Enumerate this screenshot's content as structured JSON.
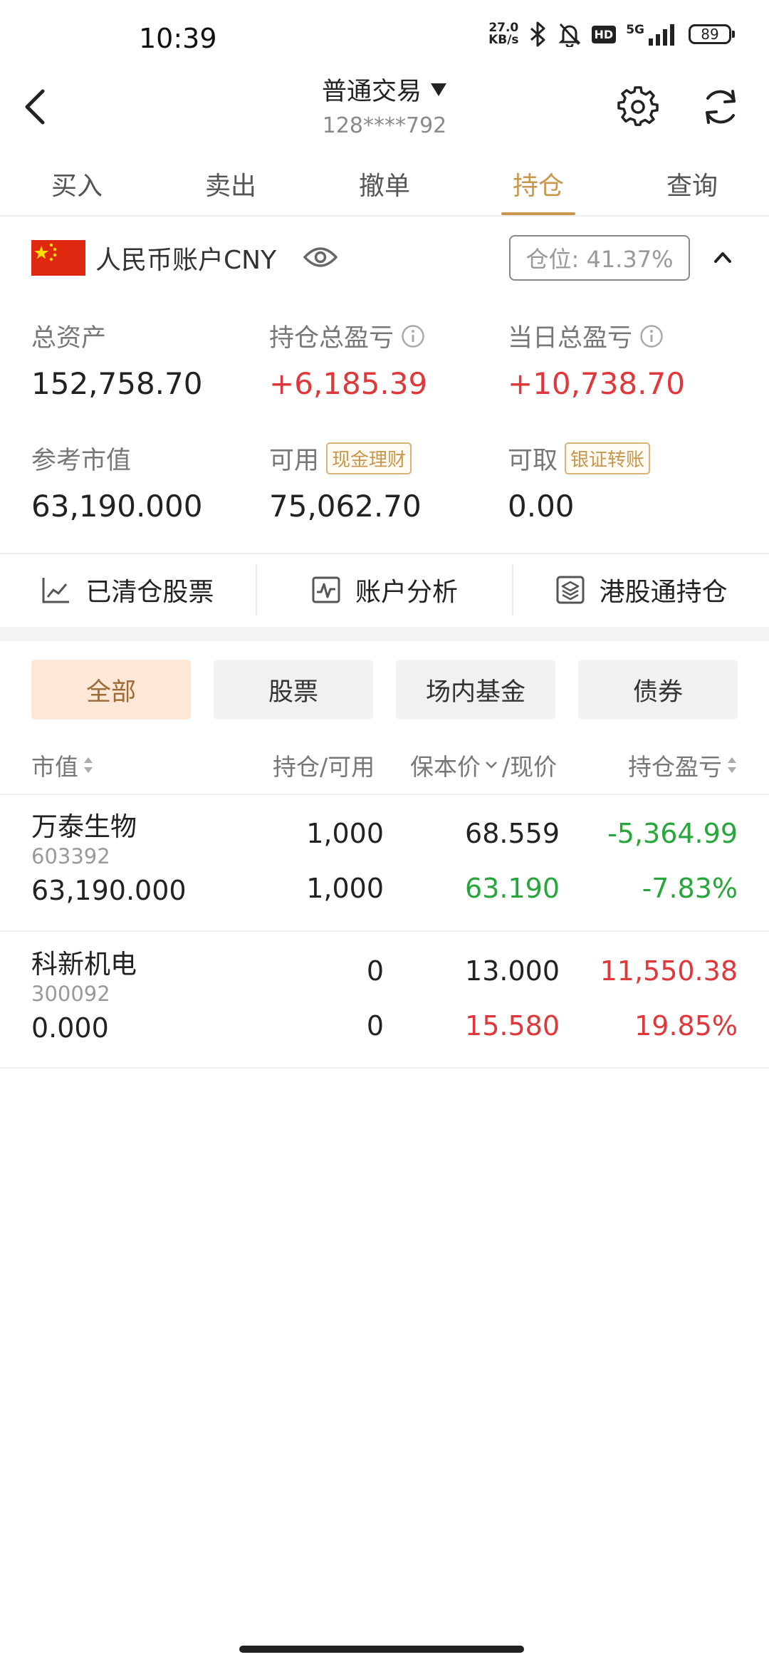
{
  "status_bar": {
    "time": "10:39",
    "net_speed_value": "27.0",
    "net_speed_unit": "KB/s",
    "hd_label": "HD",
    "signal_label": "5G",
    "battery": "89"
  },
  "header": {
    "title": "普通交易",
    "account_masked": "128****792"
  },
  "tabs": [
    {
      "label": "买入"
    },
    {
      "label": "卖出"
    },
    {
      "label": "撤单"
    },
    {
      "label": "持仓"
    },
    {
      "label": "查询"
    }
  ],
  "active_tab": "持仓",
  "account": {
    "name": "人民币账户CNY",
    "position_label": "仓位: 41.37%"
  },
  "metrics": {
    "total_assets": {
      "label": "总资产",
      "value": "152,758.70"
    },
    "holding_pl": {
      "label": "持仓总盈亏",
      "value": "+6,185.39"
    },
    "daily_pl": {
      "label": "当日总盈亏",
      "value": "+10,738.70"
    },
    "ref_market_value": {
      "label": "参考市值",
      "value": "63,190.000"
    },
    "available": {
      "label": "可用",
      "tag": "现金理财",
      "value": "75,062.70"
    },
    "withdrawable": {
      "label": "可取",
      "tag": "银证转账",
      "value": "0.00"
    }
  },
  "quick_nav": [
    {
      "label": "已清仓股票",
      "icon": "line-chart-icon"
    },
    {
      "label": "账户分析",
      "icon": "analysis-chart-icon"
    },
    {
      "label": "港股通持仓",
      "icon": "layers-icon"
    }
  ],
  "filters": [
    {
      "label": "全部"
    },
    {
      "label": "股票"
    },
    {
      "label": "场内基金"
    },
    {
      "label": "债券"
    }
  ],
  "table_headers": {
    "market_value": "市值",
    "holding_available": "持仓/可用",
    "cost_current": "保本价",
    "current_suffix": "/现价",
    "holding_pl": "持仓盈亏"
  },
  "colors": {
    "accent": "#c8974d",
    "up": "#e0373b",
    "down": "#27a63b"
  },
  "holdings": [
    {
      "name": "万泰生物",
      "code": "603392",
      "market_value": "63,190.000",
      "holding": "1,000",
      "available": "1,000",
      "cost": "68.559",
      "price": "63.190",
      "pl": "-5,364.99",
      "pl_pct": "-7.83%"
    },
    {
      "name": "科新机电",
      "code": "300092",
      "market_value": "0.000",
      "holding": "0",
      "available": "0",
      "cost": "13.000",
      "price": "15.580",
      "pl": "11,550.38",
      "pl_pct": "19.85%"
    }
  ]
}
